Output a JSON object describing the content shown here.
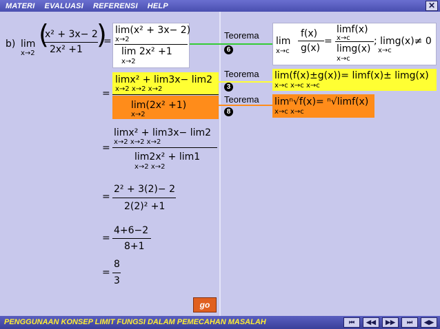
{
  "menu": {
    "materi": "MATERI",
    "evaluasi": "EVALUASI",
    "referensi": "REFERENSI",
    "help": "HELP",
    "close": "✕"
  },
  "problem": {
    "label": "b)",
    "lim": "lim",
    "sub": "x→2",
    "num": "x² + 3x− 2",
    "den": "2x² +1",
    "eq": "="
  },
  "step1": {
    "num": "lim(x² + 3x− 2)",
    "num_sub": "x→2",
    "den": "lim  2x² +1",
    "den_sub": "x→2"
  },
  "step2": {
    "eq": "=",
    "num": "limx² + lim3x− lim2",
    "num_subs": "x→2      x→2      x→2",
    "den": "lim(2x² +1)",
    "den_sub": "x→2"
  },
  "step3": {
    "eq": "=",
    "num": "limx² + lim3x− lim2",
    "num_subs": "x→2      x→2      x→2",
    "den": "lim2x² + lim1",
    "den_subs": "x→2        x→2"
  },
  "step4": {
    "eq": "=",
    "num": "2² + 3(2)− 2",
    "den": "2(2)² +1"
  },
  "step5": {
    "eq": "=",
    "num": "4+6−2",
    "den": "8+1"
  },
  "step6": {
    "eq": "=",
    "num": "8",
    "den": "3"
  },
  "theorems": [
    {
      "label": "Teorema",
      "num": "6",
      "formula_lim": "lim",
      "formula_sub": "x→c",
      "formula_num": "f(x)",
      "formula_den": "g(x)",
      "rhs_num": "limf(x)",
      "rhs_num_sub": "x→c",
      "rhs_den": "limg(x)",
      "rhs_den_sub": "x→c",
      "cond": "; limg(x)≠ 0",
      "cond_sub": "x→c"
    },
    {
      "label": "Teorema",
      "num": "3",
      "formula": "lim(f(x)±g(x))= limf(x)± limg(x)",
      "subs": "x→c                        x→c           x→c"
    },
    {
      "label": "Teorema",
      "num": "8",
      "formula": "limⁿ√f(x)= ⁿ√limf(x)",
      "subs": "x→c              x→c"
    }
  ],
  "go_label": "go",
  "footer": {
    "title": "PENGGUNAAN KONSEP LIMIT FUNGSI DALAM PEMECAHAN MASALAH",
    "nav": [
      "⏮",
      "◀◀",
      "▶▶",
      "⏭",
      "◀▶"
    ]
  },
  "colors": {
    "background": "#c8c8ec",
    "menubar": "#4a4fb0",
    "theorem_yellow": "#ffff33",
    "theorem_orange": "#ff8c1a",
    "connector_green": "#33cc33",
    "footer_text": "#ffee33"
  }
}
